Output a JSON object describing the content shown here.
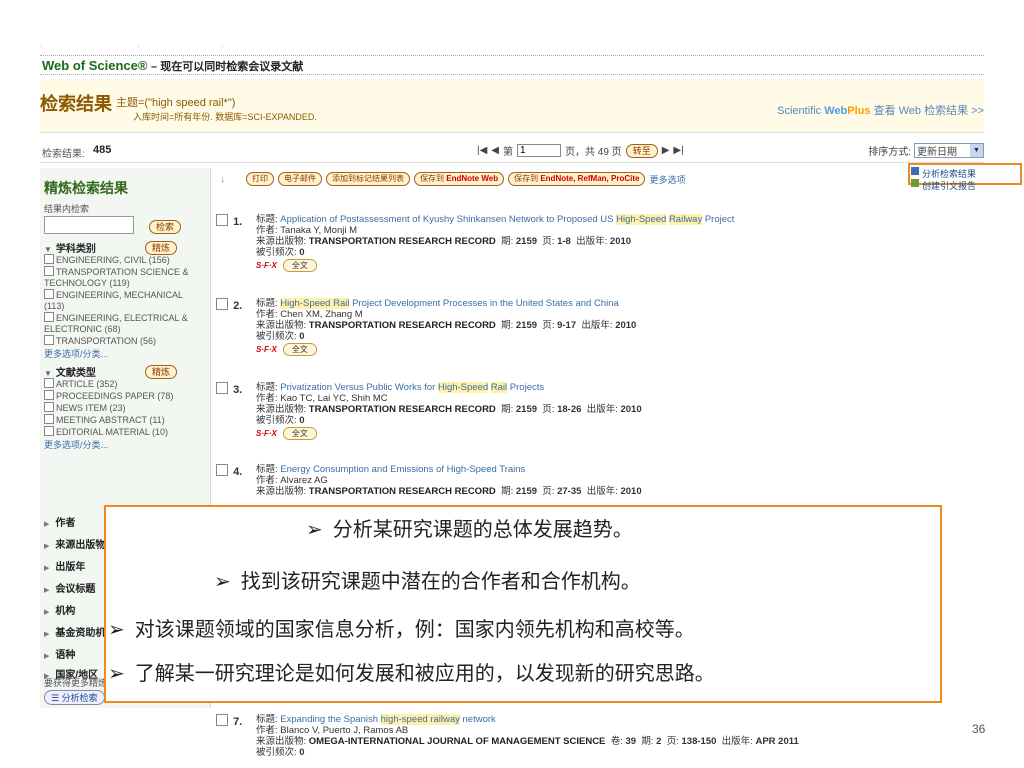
{
  "header": {
    "brand": "Web of Science®",
    "subtitle": "– 现在可以同时检索会议录文献"
  },
  "results_header": {
    "title": "检索结果",
    "topic": "主题=(\"high speed rail*\")",
    "meta": "入库时间=所有年份. 数据库=SCI-EXPANDED.",
    "right_prefix": "Scientific ",
    "webplus_web": "Web",
    "webplus_plus": "Plus",
    "right_link": "查看 Web 检索结果 >>"
  },
  "pager": {
    "count_label": "检索结果:",
    "count": "485",
    "page_prefix": "第",
    "page_value": "1",
    "page_suffix": "页，共 49 页",
    "go_label": "转至",
    "sort_label": "排序方式:",
    "sort_value": "更新日期"
  },
  "sidebar": {
    "title": "精炼检索结果",
    "search_within": "结果内检索",
    "search_button": "检索",
    "cat1": {
      "label": "学科类别",
      "refine": "精炼",
      "items": [
        "ENGINEERING, CIVIL (156)",
        "TRANSPORTATION SCIENCE & TECHNOLOGY (119)",
        "ENGINEERING, MECHANICAL (113)",
        "ENGINEERING, ELECTRICAL & ELECTRONIC (68)",
        "TRANSPORTATION (56)"
      ],
      "more": "更多选项/分类..."
    },
    "cat2": {
      "label": "文献类型",
      "refine": "精炼",
      "items": [
        "ARTICLE (352)",
        "PROCEEDINGS PAPER (78)",
        "NEWS ITEM (23)",
        "MEETING ABSTRACT (11)",
        "EDITORIAL MATERIAL (10)"
      ],
      "more": "更多选项/分类..."
    },
    "collapsed": [
      "作者",
      "来源出版物",
      "出版年",
      "会议标题",
      "机构",
      "基金资助机构",
      "语种",
      "国家/地区"
    ],
    "footer_note": "要获得更多精炼",
    "analyze_button": "分析检索"
  },
  "toolbar": {
    "print": "打印",
    "email": "电子邮件",
    "add_marked": "添加到标记结果列表",
    "save_endnote_web_prefix": "保存到",
    "save_endnote_web": "EndNote Web",
    "save_other_prefix": "保存到",
    "save_other": "EndNote, RefMan, ProCite",
    "more_options": "更多选项"
  },
  "analysis": {
    "analyze": "分析检索结果",
    "citation_report": "创建引文报告"
  },
  "records": [
    {
      "num": "1.",
      "title_pre": "Application of Postassessment of Kyushy Shinkansen Network to Proposed US ",
      "title_hl1": "High-Speed",
      "title_mid": " ",
      "title_hl2": "Railway",
      "title_post": " Project",
      "authors": "Tanaka Y, Monji M",
      "journal": "TRANSPORTATION RESEARCH RECORD",
      "issue": "2159",
      "pages": "1-8",
      "year": "2010",
      "cited": "0"
    },
    {
      "num": "2.",
      "title_pre": "",
      "title_hl1": "High-Speed Rail",
      "title_mid": "",
      "title_hl2": "",
      "title_post": " Project Development Processes in the United States and China",
      "authors": "Chen XM, Zhang M",
      "journal": "TRANSPORTATION RESEARCH RECORD",
      "issue": "2159",
      "pages": "9-17",
      "year": "2010",
      "cited": "0"
    },
    {
      "num": "3.",
      "title_pre": "Privatization Versus Public Works for ",
      "title_hl1": "High-Speed",
      "title_mid": " ",
      "title_hl2": "Rail",
      "title_post": " Projects",
      "authors": "Kao TC, Lai YC, Shih MC",
      "journal": "TRANSPORTATION RESEARCH RECORD",
      "issue": "2159",
      "pages": "18-26",
      "year": "2010",
      "cited": "0"
    },
    {
      "num": "4.",
      "title_pre": "Energy Consumption and Emissions of High-Speed Trains",
      "title_hl1": "",
      "title_mid": "",
      "title_hl2": "",
      "title_post": "",
      "authors": "Alvarez AG",
      "journal": "TRANSPORTATION RESEARCH RECORD",
      "issue": "2159",
      "pages": "27-35",
      "year": "2010",
      "cited": ""
    }
  ],
  "record7": {
    "num": "7.",
    "title_pre": "Expanding the Spanish ",
    "title_hl1": "high-speed railway",
    "title_post": " network",
    "authors": "Blanco V, Puerto J, Ramos AB",
    "journal": "OMEGA-INTERNATIONAL JOURNAL OF MANAGEMENT SCIENCE",
    "volume": "39",
    "issue": "2",
    "pages": "138-150",
    "year": "APR 2011",
    "cited": "0"
  },
  "labels": {
    "title": "标题:",
    "author": "作者:",
    "source": "来源出版物:",
    "volume": "卷",
    "issue": "期",
    "page": "页",
    "year": "出版年",
    "cited": "被引频次:",
    "fulltext": "全文",
    "sfx": "S·F·X"
  },
  "overlay": {
    "marker": "➢",
    "lines": [
      "分析某研究课题的总体发展趋势。",
      "找到该研究课题中潜在的合作者和合作机构。",
      "对该课题领域的国家信息分析，例：国家内领先机构和高校等。",
      "了解某一研究理论是如何发展和被应用的，以发现新的研究思路。"
    ]
  },
  "slide_number": "36"
}
